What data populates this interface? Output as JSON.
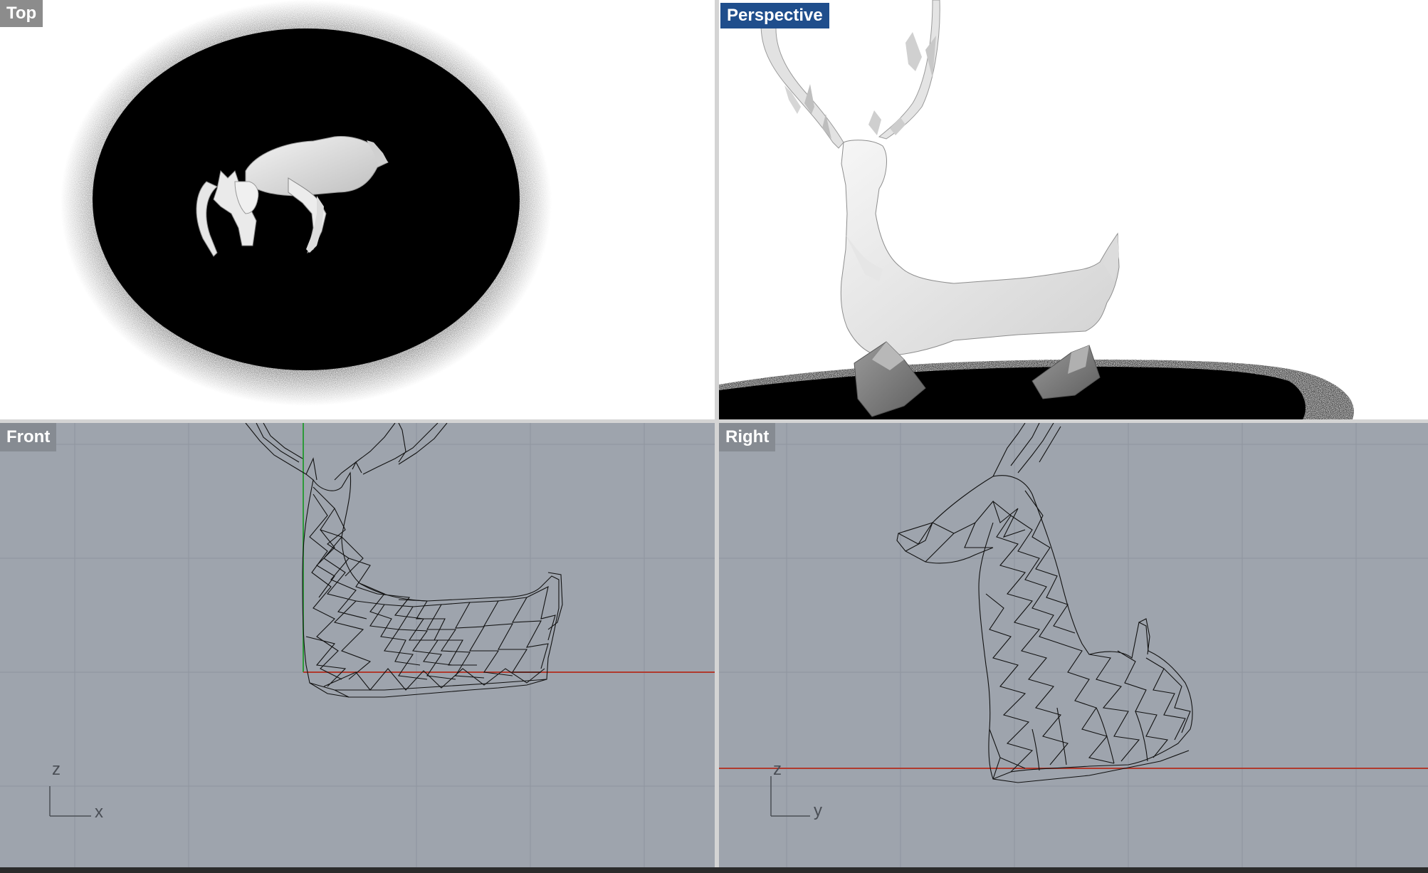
{
  "viewports": {
    "top": {
      "label": "Top"
    },
    "perspective": {
      "label": "Perspective"
    },
    "front": {
      "label": "Front",
      "axis_h": "x",
      "axis_v": "z"
    },
    "right": {
      "label": "Right",
      "axis_h": "y",
      "axis_v": "z"
    }
  },
  "colors": {
    "active_viewport_label": "#1f4e8c",
    "inactive_viewport_label": "#8c8c8c",
    "wireframe_background": "#9ea4ad",
    "x_axis": "#b03a2e",
    "z_axis": "#2e9a3a"
  },
  "icons": {
    "model": "deer-model",
    "shadow": "ground-shadow"
  }
}
